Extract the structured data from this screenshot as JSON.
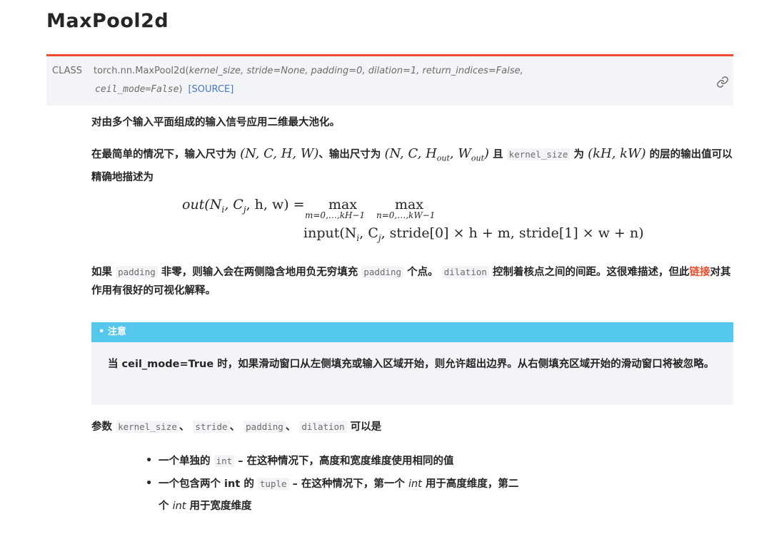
{
  "title": "MaxPool2d",
  "signature": {
    "class_label": "CLASS",
    "name": "torch.nn.MaxPool2d",
    "open_paren": "(",
    "params_line1": "kernel_size, stride=None, padding=0, dilation=1, return_indices=False,",
    "params_line2": "ceil_mode=False",
    "close_paren": ")",
    "source_label": "[SOURCE]"
  },
  "para1": "对由多个输入平面组成的输入信号应用二维最大池化。",
  "para2": {
    "p1": "在最简单的情况下，输入尺寸为",
    "in_size": "(N, C, H, W)",
    "p2": "、输出尺寸为",
    "out_size_start": "(N, C, H",
    "out_sub1": "out",
    "out_mid": ", W",
    "out_sub2": "out",
    "out_end": ")",
    "p3": "且",
    "code": "kernel_size",
    "p4": "为",
    "kernel_math": "(kH, kW)",
    "p5": "的层的输出值可以精确地描述为"
  },
  "formula": {
    "lhs": "out(N",
    "lhs_i": "i",
    "lhs_mid": ", C",
    "lhs_j": "j",
    "lhs_end": ", h, w) =",
    "max1": "max",
    "max1_sub": "m=0,…,kH−1",
    "max2": "max",
    "max2_sub": "n=0,…,kW−1",
    "rhs": "input(N",
    "rhs_i": "i",
    "rhs_mid": ", C",
    "rhs_j": "j",
    "rhs_end": ", stride[0] × h + m, stride[1] × w + n)"
  },
  "para3": {
    "p1": "如果",
    "code1": "padding",
    "p2": "非零，则输入会在两侧隐含地用负无穷填充",
    "code2": "padding",
    "p3": "个点。",
    "code3": "dilation",
    "p4": "控制着核点之间的间距。这很难描述，但此",
    "link": "链接",
    "p5": "对其作用有很好的可视化解释。"
  },
  "note": {
    "header": "• 注意",
    "body": "当 ceil_mode=True 时，如果滑动窗口从左侧填充或输入区域开始，则允许超出边界。从右侧填充区域开始的滑动窗口将被忽略。"
  },
  "para4": {
    "p1": "参数",
    "code1": "kernel_size",
    "sep1": "、",
    "code2": "stride",
    "sep2": "、",
    "code3": "padding",
    "sep3": "、",
    "code4": "dilation",
    "p2": "可以是"
  },
  "bullets": [
    {
      "p1": "一个单独的",
      "code": "int",
      "p2": "– 在这种情况下，高度和宽度维度使用相同的值"
    },
    {
      "p1": "一个包含两个 int 的",
      "code": "tuple",
      "p2": "– 在这种情况下，第一个",
      "it1": "int",
      "p3": "用于高度维度，第二",
      "p4": "个",
      "it2": "int",
      "p5": "用于宽度维度"
    }
  ],
  "colors": {
    "accent": "#ee4c2c",
    "note_header": "#54c7ec",
    "link": "#ee4c2c",
    "source": "#4878c8"
  },
  "icons": {
    "permalink": "link-icon"
  }
}
